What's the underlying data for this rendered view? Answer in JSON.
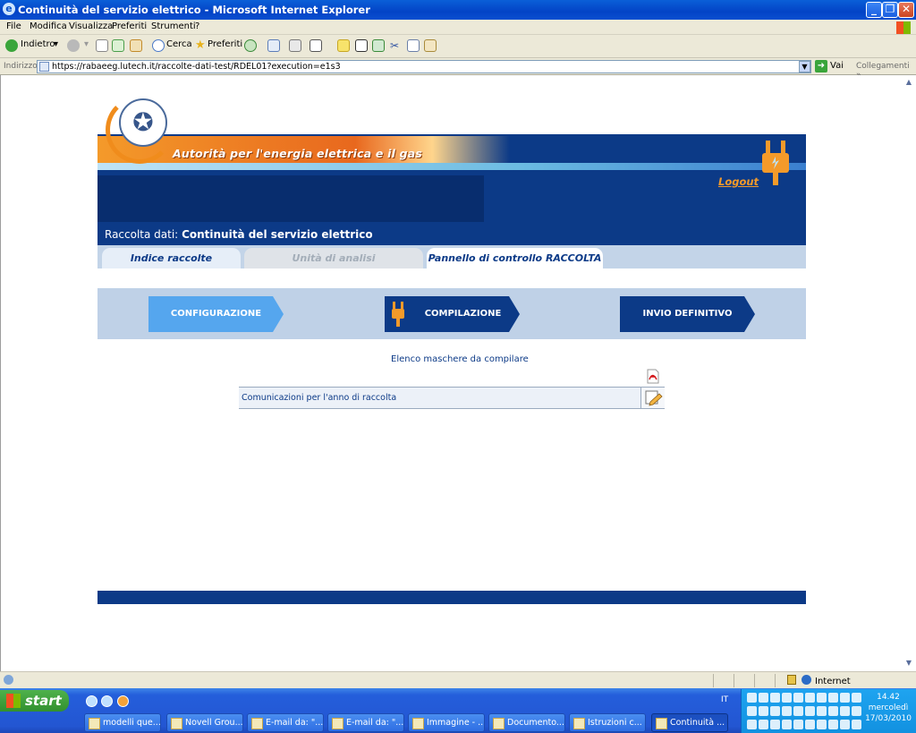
{
  "window": {
    "title": "Continuità del servizio elettrico - Microsoft Internet Explorer",
    "minimize": "_",
    "maximize": "❐",
    "close": "✕"
  },
  "menu": [
    "File",
    "Modifica",
    "Visualizza",
    "Preferiti",
    "Strumenti",
    "?"
  ],
  "toolbar": {
    "back": "Indietro",
    "search": "Cerca",
    "favorites": "Preferiti"
  },
  "address": {
    "label": "Indirizzo",
    "url": "https://rabaeeg.lutech.it/raccolte-dati-test/RDEL01?execution=e1s3",
    "go": "Vai",
    "links": "Collegamenti"
  },
  "site": {
    "banner_title": "Autorità per l'energia elettrica e il gas",
    "logout": "Logout",
    "raccolta_prefix": "Raccolta dati:",
    "raccolta_name": "Continuità del servizio elettrico",
    "tabs": [
      {
        "label": "Indice raccolte",
        "state": "normal"
      },
      {
        "label": "Unità di analisi",
        "state": "disabled"
      },
      {
        "label": "Pannello di controllo RACCOLTA",
        "state": "active"
      }
    ],
    "steps": [
      {
        "label": "CONFIGURAZIONE",
        "state": "done"
      },
      {
        "label": "COMPILAZIONE",
        "state": "current"
      },
      {
        "label": "INVIO DEFINITIVO",
        "state": "todo"
      }
    ],
    "list_title": "Elenco maschere da compilare",
    "rows": [
      {
        "label": "Comunicazioni per l'anno di raccolta"
      }
    ]
  },
  "status": {
    "zone": "Internet"
  },
  "taskbar": {
    "start": "start",
    "tasks": [
      "modelli que...",
      "Novell Grou...",
      "E-mail da: \"...",
      "E-mail da: \"...",
      "Immagine - ...",
      "Documento...",
      "Istruzioni c...",
      "Continuità ..."
    ],
    "lang": "IT",
    "time": "14.42",
    "day": "mercoledì",
    "date": "17/03/2010"
  },
  "colors": {
    "navy": "#0c3a87",
    "orange": "#f49a2a",
    "step_done": "#55a6ee"
  }
}
